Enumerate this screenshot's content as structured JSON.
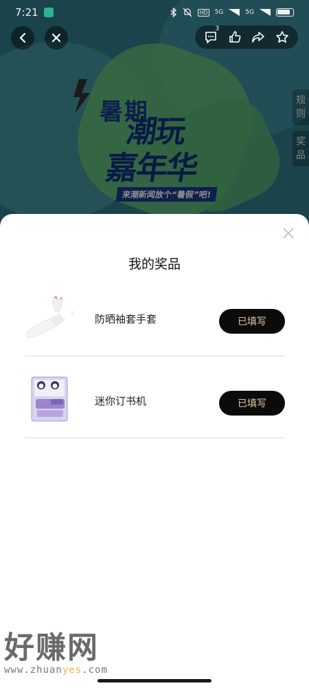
{
  "status_bar": {
    "time": "7:21",
    "icons": [
      "home-app-icon",
      "bluetooth-icon",
      "mute-icon",
      "hd-icon",
      "signal-5g-icon",
      "signal-icon",
      "battery-icon"
    ],
    "network_labels": [
      "HD",
      "5G",
      "5G"
    ]
  },
  "nav": {
    "back_icon": "chevron-left-icon",
    "close_icon": "close-icon",
    "comment_count": "3",
    "actions": [
      "comment-icon",
      "like-icon",
      "share-icon",
      "star-icon"
    ]
  },
  "background_page": {
    "title_line1": "暑期",
    "title_line2": "潮玩",
    "title_line3": "嘉年华",
    "subtitle": "来潮新闻放个“暑假”吧!",
    "side_tab_rules": "规则",
    "side_tab_prizes": "奖品"
  },
  "sheet": {
    "title": "我的奖品",
    "close_icon": "close-icon",
    "prizes": [
      {
        "name": "防晒袖套手套",
        "button": "已填写",
        "image": "sleeve-glove-image"
      },
      {
        "name": "迷你订书机",
        "button": "已填写",
        "image": "mini-stapler-image"
      }
    ]
  },
  "watermark": {
    "big": "好赚网",
    "url_pre": "www.zhuan",
    "url_hl": "yes",
    "url_post": ".com"
  },
  "colors": {
    "button_bg": "#0b0b0b",
    "button_text": "#e7c9a4",
    "divider": "#e4dccb",
    "watermark_highlight": "#f2b233"
  }
}
